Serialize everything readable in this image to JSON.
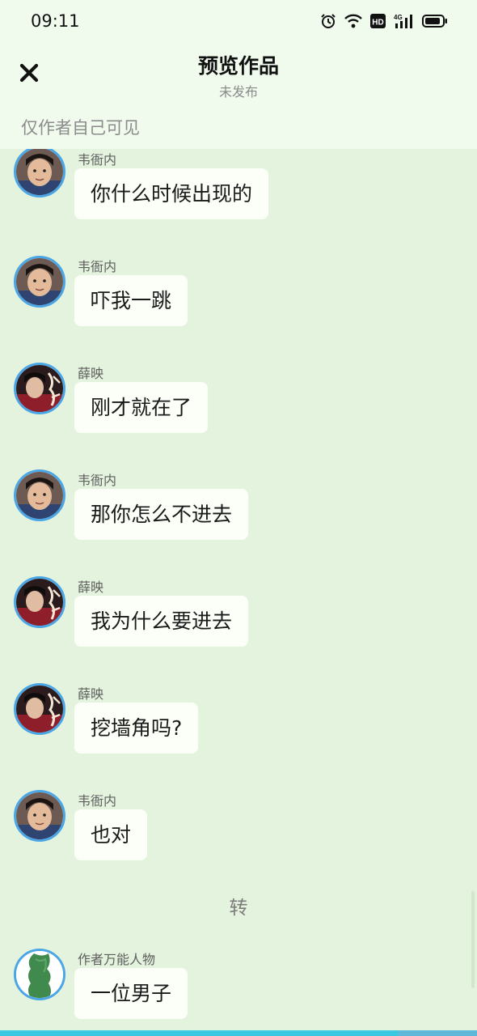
{
  "status_bar": {
    "time": "09:11",
    "icons": [
      "alarm-icon",
      "wifi-icon",
      "hd-icon",
      "4g-signal-icon",
      "battery-icon"
    ],
    "hd_label": "HD",
    "network_label": "4G"
  },
  "header": {
    "title": "预览作品",
    "subtitle": "未发布",
    "visibility_note": "仅作者自己可见",
    "close_icon": "close-icon"
  },
  "messages": [
    {
      "sender": "韦衙内",
      "text": "你什么时候出现的",
      "avatar": "avatar-weiyanei"
    },
    {
      "sender": "韦衙内",
      "text": "吓我一跳",
      "avatar": "avatar-weiyanei"
    },
    {
      "sender": "薛映",
      "text": "刚才就在了",
      "avatar": "avatar-xueying"
    },
    {
      "sender": "韦衙内",
      "text": "那你怎么不进去",
      "avatar": "avatar-weiyanei"
    },
    {
      "sender": "薛映",
      "text": "我为什么要进去",
      "avatar": "avatar-xueying"
    },
    {
      "sender": "薛映",
      "text": "挖墙角吗?",
      "avatar": "avatar-xueying"
    },
    {
      "sender": "韦衙内",
      "text": "也对",
      "avatar": "avatar-weiyanei"
    }
  ],
  "separator": "转",
  "last_message": {
    "sender": "作者万能人物",
    "text": "一位男子",
    "avatar": "avatar-narrator"
  },
  "colors": {
    "background": "#e3f3dd",
    "header": "#f0fbee",
    "bubble": "#fbfff8",
    "avatar_ring": "#4ba6e6",
    "progress": "#39c8df"
  },
  "progress": 0.835
}
